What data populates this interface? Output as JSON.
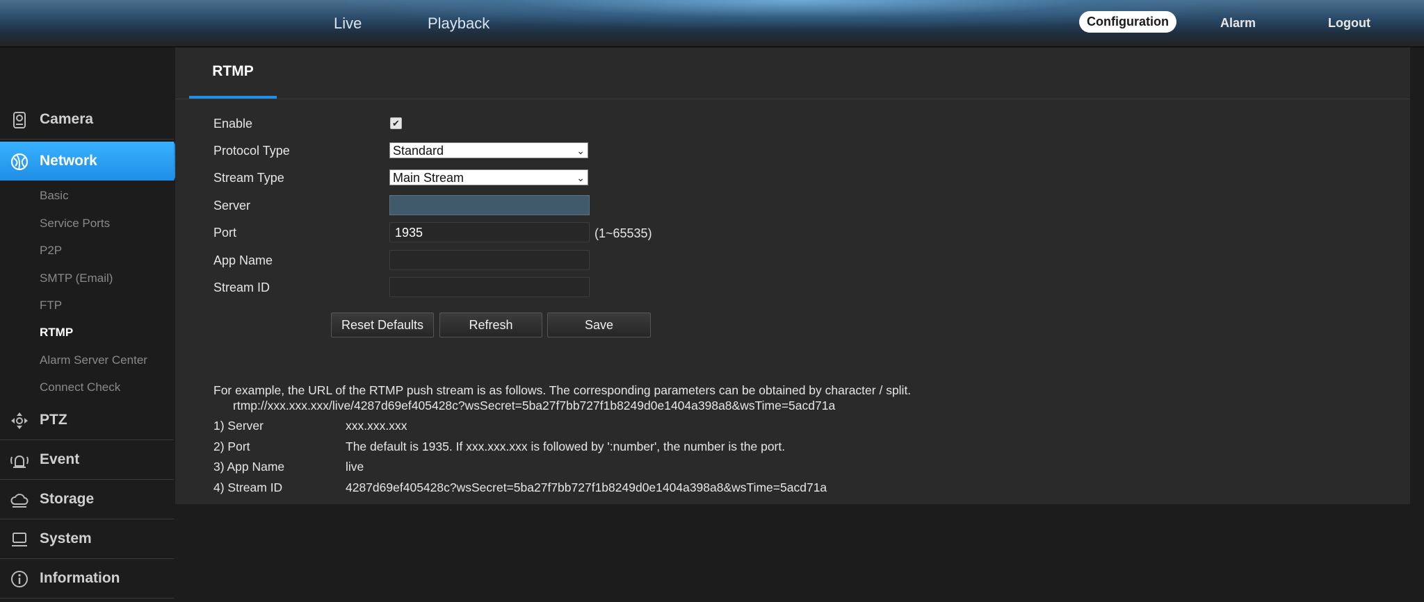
{
  "topnav": {
    "live": "Live",
    "playback": "Playback",
    "configuration": "Configuration",
    "alarm": "Alarm",
    "logout": "Logout"
  },
  "sidebar": {
    "categories": [
      {
        "label": "Camera",
        "icon": "camera-icon"
      },
      {
        "label": "Network",
        "icon": "network-icon"
      },
      {
        "label": "PTZ",
        "icon": "ptz-icon"
      },
      {
        "label": "Event",
        "icon": "event-icon"
      },
      {
        "label": "Storage",
        "icon": "storage-icon"
      },
      {
        "label": "System",
        "icon": "system-icon"
      },
      {
        "label": "Information",
        "icon": "information-icon"
      }
    ],
    "network_items": [
      "Basic",
      "Service Ports",
      "P2P",
      "SMTP (Email)",
      "FTP",
      "RTMP",
      "Alarm Server Center",
      "Connect Check"
    ],
    "active_category": "Network",
    "active_item": "RTMP"
  },
  "main": {
    "tab": "RTMP",
    "form": {
      "enable_label": "Enable",
      "enable_checked": true,
      "protocol_label": "Protocol Type",
      "protocol_value": "Standard",
      "stream_type_label": "Stream Type",
      "stream_type_value": "Main Stream",
      "server_label": "Server",
      "server_value": "",
      "port_label": "Port",
      "port_value": "1935",
      "port_hint": "(1~65535)",
      "app_name_label": "App Name",
      "app_name_value": "",
      "stream_id_label": "Stream ID",
      "stream_id_value": ""
    },
    "buttons": {
      "reset": "Reset Defaults",
      "refresh": "Refresh",
      "save": "Save"
    },
    "notes": {
      "intro": "For example, the URL of the RTMP push stream is as follows. The corresponding parameters can be obtained by character / split.",
      "url": "rtmp://xxx.xxx.xxx/live/4287d69ef405428c?wsSecret=5ba27f7bb727f1b8249d0e1404a398a8&wsTime=5acd71a",
      "params": [
        {
          "name": "1) Server",
          "value": "xxx.xxx.xxx"
        },
        {
          "name": "2) Port",
          "value": "The default is 1935. If xxx.xxx.xxx is followed by ':number', the number is the port."
        },
        {
          "name": "3) App Name",
          "value": "live"
        },
        {
          "name": "4) Stream ID",
          "value": "4287d69ef405428c?wsSecret=5ba27f7bb727f1b8249d0e1404a398a8&wsTime=5acd71a"
        }
      ]
    }
  },
  "colors": {
    "accent": "#1f8ee6",
    "panel": "#2a2a2a",
    "background": "#1c1c1c"
  }
}
